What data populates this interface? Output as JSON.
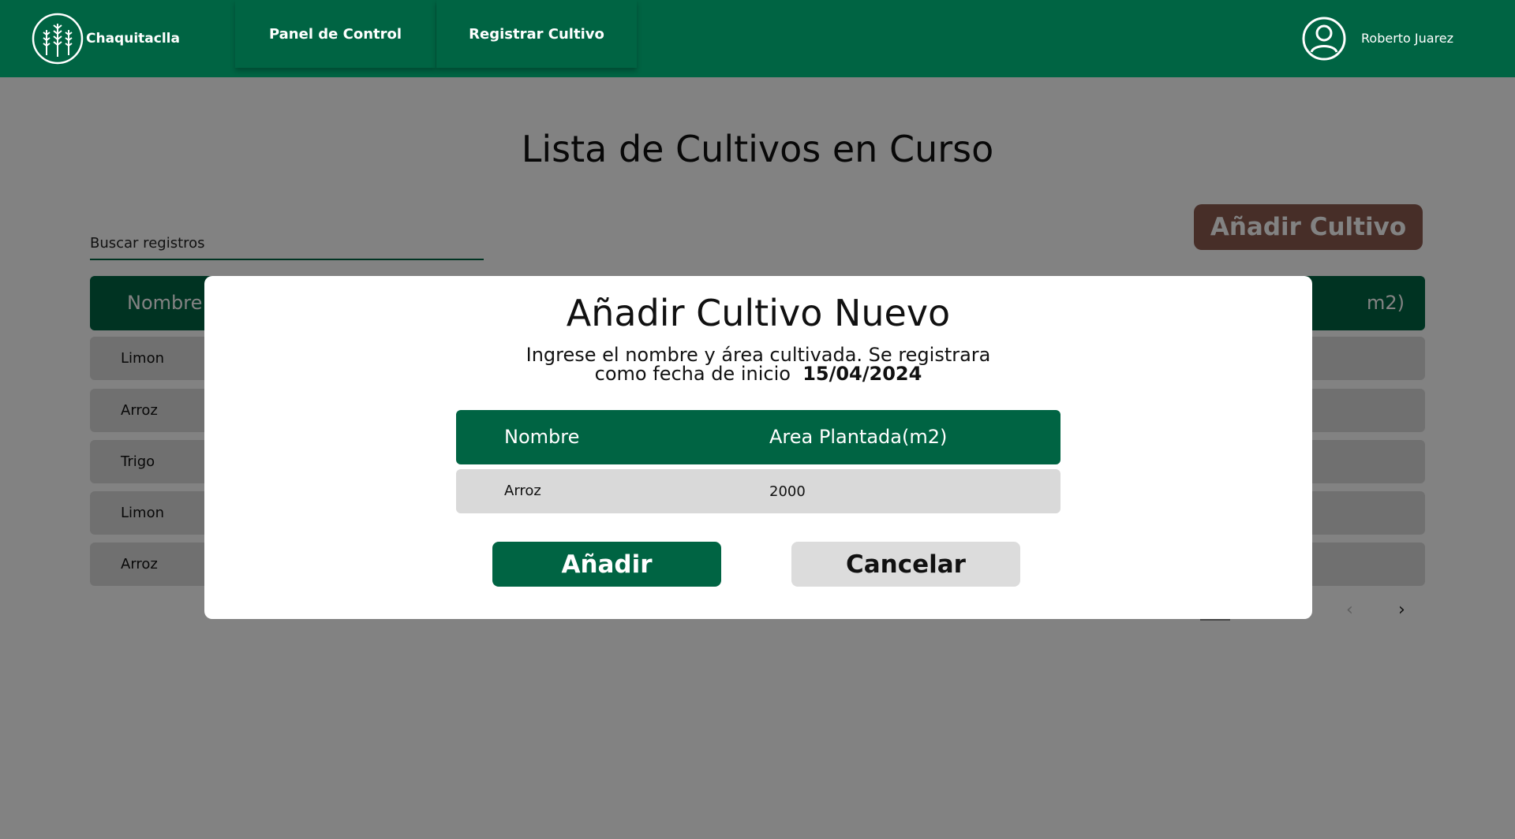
{
  "header": {
    "brand": "Chaquitaclla",
    "nav": [
      {
        "label": "Panel de Control"
      },
      {
        "label": "Registrar Cultivo"
      }
    ],
    "user_name": "Roberto Juarez",
    "accent": "#006443"
  },
  "main": {
    "title": "Lista de Cultivos en Curso",
    "search_placeholder": "Buscar registros",
    "add_button": "Añadir Cultivo",
    "table": {
      "col_name": "Nombre",
      "col_area_tail": "m2)",
      "rows": [
        "Limon",
        "Arroz",
        "Trigo",
        "Limon",
        "Arroz"
      ]
    },
    "pager": {
      "prev_icon": "chevron-left-icon",
      "next_icon": "chevron-right-icon"
    }
  },
  "modal": {
    "title": "Añadir Cultivo Nuevo",
    "desc_line1": "Ingrese el nombre y área cultivada. Se registrara",
    "desc_line2": "como fecha de inicio",
    "date": "15/04/2024",
    "col_name": "Nombre",
    "col_area": "Area Plantada(m2)",
    "row_name": "Arroz",
    "row_area": "2000",
    "confirm": "Añadir",
    "cancel": "Cancelar"
  }
}
